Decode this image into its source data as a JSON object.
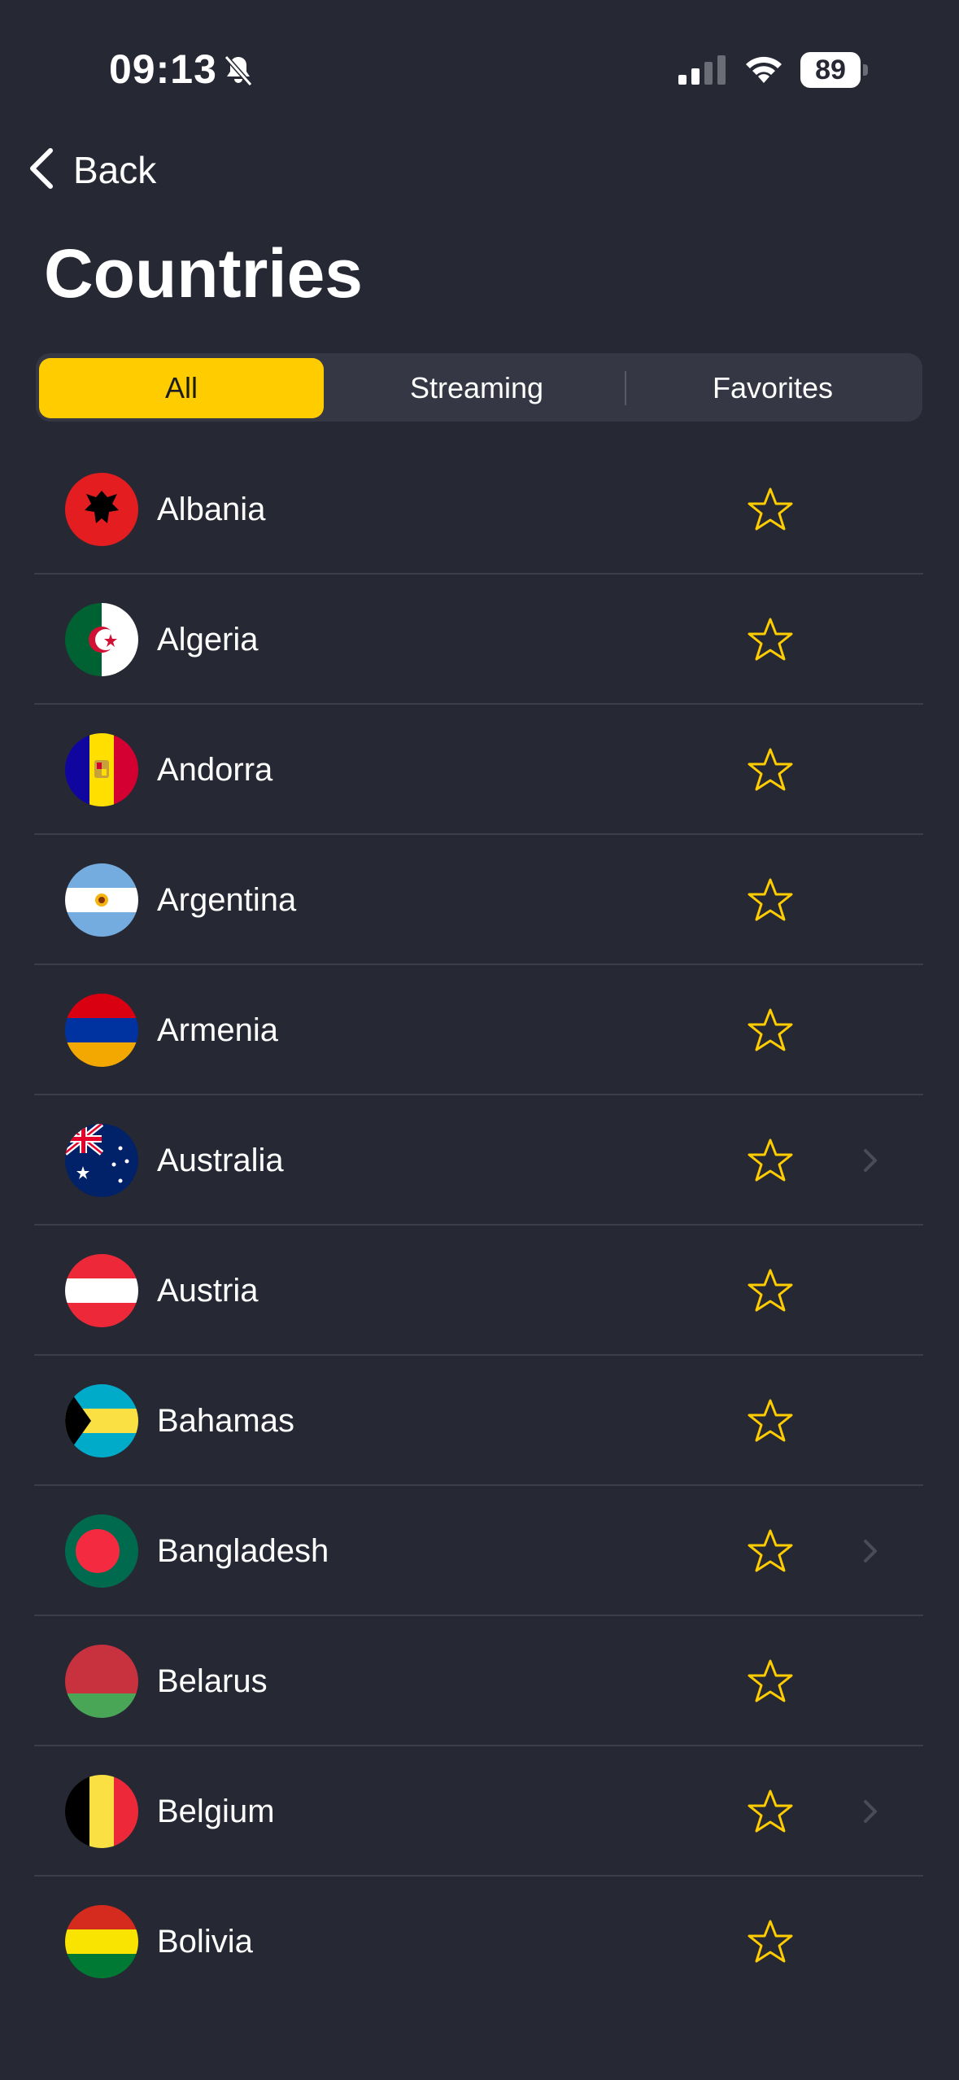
{
  "status_bar": {
    "time": "09:13",
    "battery": "89"
  },
  "nav": {
    "back_label": "Back",
    "title": "Countries"
  },
  "tabs": [
    {
      "label": "All",
      "active": true
    },
    {
      "label": "Streaming",
      "active": false
    },
    {
      "label": "Favorites",
      "active": false
    }
  ],
  "colors": {
    "accent": "#ffcc00",
    "background": "#262834",
    "star": "#ffcc00"
  },
  "countries": [
    {
      "name": "Albania",
      "flag": "albania-flag-icon",
      "chevron": false
    },
    {
      "name": "Algeria",
      "flag": "algeria-flag-icon",
      "chevron": false
    },
    {
      "name": "Andorra",
      "flag": "andorra-flag-icon",
      "chevron": false
    },
    {
      "name": "Argentina",
      "flag": "argentina-flag-icon",
      "chevron": false
    },
    {
      "name": "Armenia",
      "flag": "armenia-flag-icon",
      "chevron": false
    },
    {
      "name": "Australia",
      "flag": "australia-flag-icon",
      "chevron": true
    },
    {
      "name": "Austria",
      "flag": "austria-flag-icon",
      "chevron": false
    },
    {
      "name": "Bahamas",
      "flag": "bahamas-flag-icon",
      "chevron": false
    },
    {
      "name": "Bangladesh",
      "flag": "bangladesh-flag-icon",
      "chevron": true
    },
    {
      "name": "Belarus",
      "flag": "belarus-flag-icon",
      "chevron": false
    },
    {
      "name": "Belgium",
      "flag": "belgium-flag-icon",
      "chevron": true
    },
    {
      "name": "Bolivia",
      "flag": "bolivia-flag-icon",
      "chevron": false
    }
  ]
}
